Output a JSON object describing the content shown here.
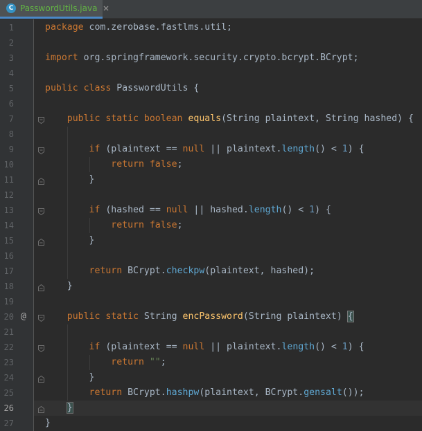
{
  "tab": {
    "icon_letter": "C",
    "filename": "PasswordUtils.java",
    "close_icon": "close-icon"
  },
  "editor": {
    "current_line": 26,
    "override_marker": "@",
    "lines": [
      {
        "n": "1",
        "fold": "",
        "tokens": [
          [
            "kw",
            "package "
          ],
          [
            "pl",
            "com.zerobase.fastlms.util;"
          ]
        ]
      },
      {
        "n": "2",
        "fold": "",
        "tokens": []
      },
      {
        "n": "3",
        "fold": "",
        "tokens": [
          [
            "kw",
            "import "
          ],
          [
            "pl",
            "org.springframework.security.crypto.bcrypt.BCrypt;"
          ]
        ]
      },
      {
        "n": "4",
        "fold": "",
        "tokens": []
      },
      {
        "n": "5",
        "fold": "",
        "tokens": [
          [
            "kw",
            "public class "
          ],
          [
            "pl",
            "PasswordUtils {"
          ]
        ]
      },
      {
        "n": "6",
        "fold": "",
        "tokens": []
      },
      {
        "n": "7",
        "fold": "open",
        "tokens": [
          [
            "ws",
            "    "
          ],
          [
            "kw",
            "public static boolean "
          ],
          [
            "fn",
            "equals"
          ],
          [
            "pl",
            "(String plaintext, String hashed) {"
          ]
        ]
      },
      {
        "n": "8",
        "fold": "",
        "tokens": []
      },
      {
        "n": "9",
        "fold": "open",
        "tokens": [
          [
            "ws",
            "        "
          ],
          [
            "kw",
            "if "
          ],
          [
            "pl",
            "(plaintext == "
          ],
          [
            "kw",
            "null "
          ],
          [
            "pl",
            "|| plaintext."
          ],
          [
            "mc",
            "length"
          ],
          [
            "pl",
            "() < "
          ],
          [
            "nu",
            "1"
          ],
          [
            "pl",
            ") {"
          ]
        ]
      },
      {
        "n": "10",
        "fold": "",
        "tokens": [
          [
            "ws",
            "            "
          ],
          [
            "kw",
            "return false"
          ],
          [
            "pl",
            ";"
          ]
        ]
      },
      {
        "n": "11",
        "fold": "close",
        "tokens": [
          [
            "ws",
            "        "
          ],
          [
            "pl",
            "}"
          ]
        ]
      },
      {
        "n": "12",
        "fold": "",
        "tokens": []
      },
      {
        "n": "13",
        "fold": "open",
        "tokens": [
          [
            "ws",
            "        "
          ],
          [
            "kw",
            "if "
          ],
          [
            "pl",
            "(hashed == "
          ],
          [
            "kw",
            "null "
          ],
          [
            "pl",
            "|| hashed."
          ],
          [
            "mc",
            "length"
          ],
          [
            "pl",
            "() < "
          ],
          [
            "nu",
            "1"
          ],
          [
            "pl",
            ") {"
          ]
        ]
      },
      {
        "n": "14",
        "fold": "",
        "tokens": [
          [
            "ws",
            "            "
          ],
          [
            "kw",
            "return false"
          ],
          [
            "pl",
            ";"
          ]
        ]
      },
      {
        "n": "15",
        "fold": "close",
        "tokens": [
          [
            "ws",
            "        "
          ],
          [
            "pl",
            "}"
          ]
        ]
      },
      {
        "n": "16",
        "fold": "",
        "tokens": []
      },
      {
        "n": "17",
        "fold": "",
        "tokens": [
          [
            "ws",
            "        "
          ],
          [
            "kw",
            "return "
          ],
          [
            "pl",
            "BCrypt."
          ],
          [
            "mc",
            "checkpw"
          ],
          [
            "pl",
            "(plaintext, hashed);"
          ]
        ]
      },
      {
        "n": "18",
        "fold": "close",
        "tokens": [
          [
            "ws",
            "    "
          ],
          [
            "pl",
            "}"
          ]
        ]
      },
      {
        "n": "19",
        "fold": "",
        "tokens": []
      },
      {
        "n": "20",
        "fold": "open",
        "tokens": [
          [
            "ws",
            "    "
          ],
          [
            "kw",
            "public static "
          ],
          [
            "pl",
            "String "
          ],
          [
            "fn",
            "encPassword"
          ],
          [
            "pl",
            "(String plaintext) "
          ],
          [
            "bh",
            "{"
          ]
        ]
      },
      {
        "n": "21",
        "fold": "",
        "tokens": []
      },
      {
        "n": "22",
        "fold": "open",
        "tokens": [
          [
            "ws",
            "        "
          ],
          [
            "kw",
            "if "
          ],
          [
            "pl",
            "(plaintext == "
          ],
          [
            "kw",
            "null "
          ],
          [
            "pl",
            "|| plaintext."
          ],
          [
            "mc",
            "length"
          ],
          [
            "pl",
            "() < "
          ],
          [
            "nu",
            "1"
          ],
          [
            "pl",
            ") {"
          ]
        ]
      },
      {
        "n": "23",
        "fold": "",
        "tokens": [
          [
            "ws",
            "            "
          ],
          [
            "kw",
            "return "
          ],
          [
            "st",
            "\"\""
          ],
          [
            "pl",
            ";"
          ]
        ]
      },
      {
        "n": "24",
        "fold": "close",
        "tokens": [
          [
            "ws",
            "        "
          ],
          [
            "pl",
            "}"
          ]
        ]
      },
      {
        "n": "25",
        "fold": "",
        "tokens": [
          [
            "ws",
            "        "
          ],
          [
            "kw",
            "return "
          ],
          [
            "pl",
            "BCrypt."
          ],
          [
            "mc",
            "hashpw"
          ],
          [
            "pl",
            "(plaintext, BCrypt."
          ],
          [
            "mc",
            "gensalt"
          ],
          [
            "pl",
            "());"
          ]
        ]
      },
      {
        "n": "26",
        "fold": "close",
        "tokens": [
          [
            "ws",
            "    "
          ],
          [
            "bm",
            "}"
          ]
        ]
      },
      {
        "n": "27",
        "fold": "",
        "tokens": [
          [
            "pl",
            "}"
          ]
        ]
      }
    ]
  },
  "colors": {
    "background": "#2b2b2b",
    "gutter": "#313335",
    "keyword": "#cc7832",
    "method_decl": "#ffc66d",
    "method_call": "#5fa8d3",
    "number": "#6897bb",
    "string": "#6a8759",
    "text": "#a9b7c6",
    "tab_label": "#62b543",
    "tab_underline": "#4a88c7"
  }
}
